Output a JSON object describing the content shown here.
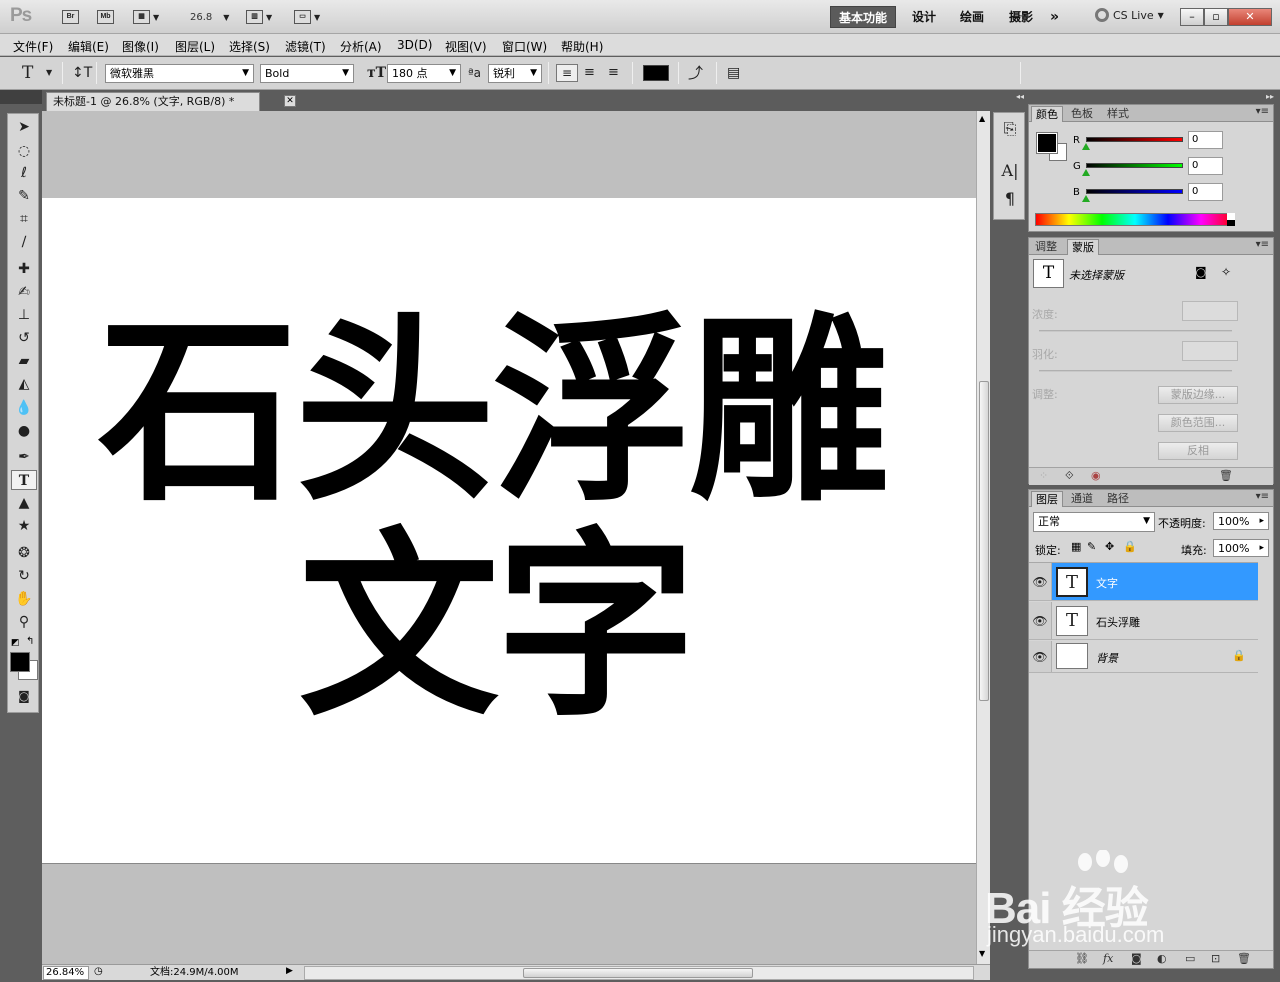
{
  "appbar": {
    "logo": "Ps",
    "bridge": "Br",
    "mini_bridge": "Mb",
    "zoom_value": "26.8",
    "workspaces": [
      "基本功能",
      "设计",
      "绘画",
      "摄影"
    ],
    "more": "»",
    "cs_live": "CS Live",
    "window_buttons": [
      "–",
      "▫",
      "✕"
    ]
  },
  "menu": [
    "文件(F)",
    "编辑(E)",
    "图像(I)",
    "图层(L)",
    "选择(S)",
    "滤镜(T)",
    "分析(A)",
    "3D(D)",
    "视图(V)",
    "窗口(W)",
    "帮助(H)"
  ],
  "options": {
    "font_family": "微软雅黑",
    "font_style": "Bold",
    "font_size": "180 点",
    "aa_label": "ªa",
    "antialias": "锐利",
    "color": "#000000"
  },
  "document": {
    "tab_title": "未标题-1 @ 26.8% (文字, RGB/8) *",
    "line1": "石头浮雕",
    "line2": "文字",
    "zoom": "26.84%",
    "doc_info": "文档:24.9M/4.00M"
  },
  "color_panel": {
    "tabs": [
      "颜色",
      "色板",
      "样式"
    ],
    "channels": [
      {
        "label": "R",
        "value": "0",
        "gradient": "#ff0000"
      },
      {
        "label": "G",
        "value": "0",
        "gradient": "#00ff00"
      },
      {
        "label": "B",
        "value": "0",
        "gradient": "#0000ff"
      }
    ]
  },
  "masks_panel": {
    "tabs": [
      "调整",
      "蒙版"
    ],
    "no_mask": "未选择蒙版",
    "density_label": "浓度:",
    "feather_label": "羽化:",
    "refine_label": "调整:",
    "buttons": [
      "蒙版边缘...",
      "颜色范围...",
      "反相"
    ]
  },
  "layers_panel": {
    "tabs": [
      "图层",
      "通道",
      "路径"
    ],
    "blend_mode": "正常",
    "opacity_label": "不透明度:",
    "opacity": "100%",
    "lock_label": "锁定:",
    "fill_label": "填充:",
    "fill": "100%",
    "layers": [
      {
        "name": "文字",
        "thumb": "T",
        "selected": true
      },
      {
        "name": "石头浮雕",
        "thumb": "T",
        "selected": false
      },
      {
        "name": "背景",
        "thumb": "",
        "selected": false,
        "locked": true
      }
    ]
  },
  "watermark": {
    "brand": "Bai 经验",
    "url": "jingyan.baidu.com"
  }
}
